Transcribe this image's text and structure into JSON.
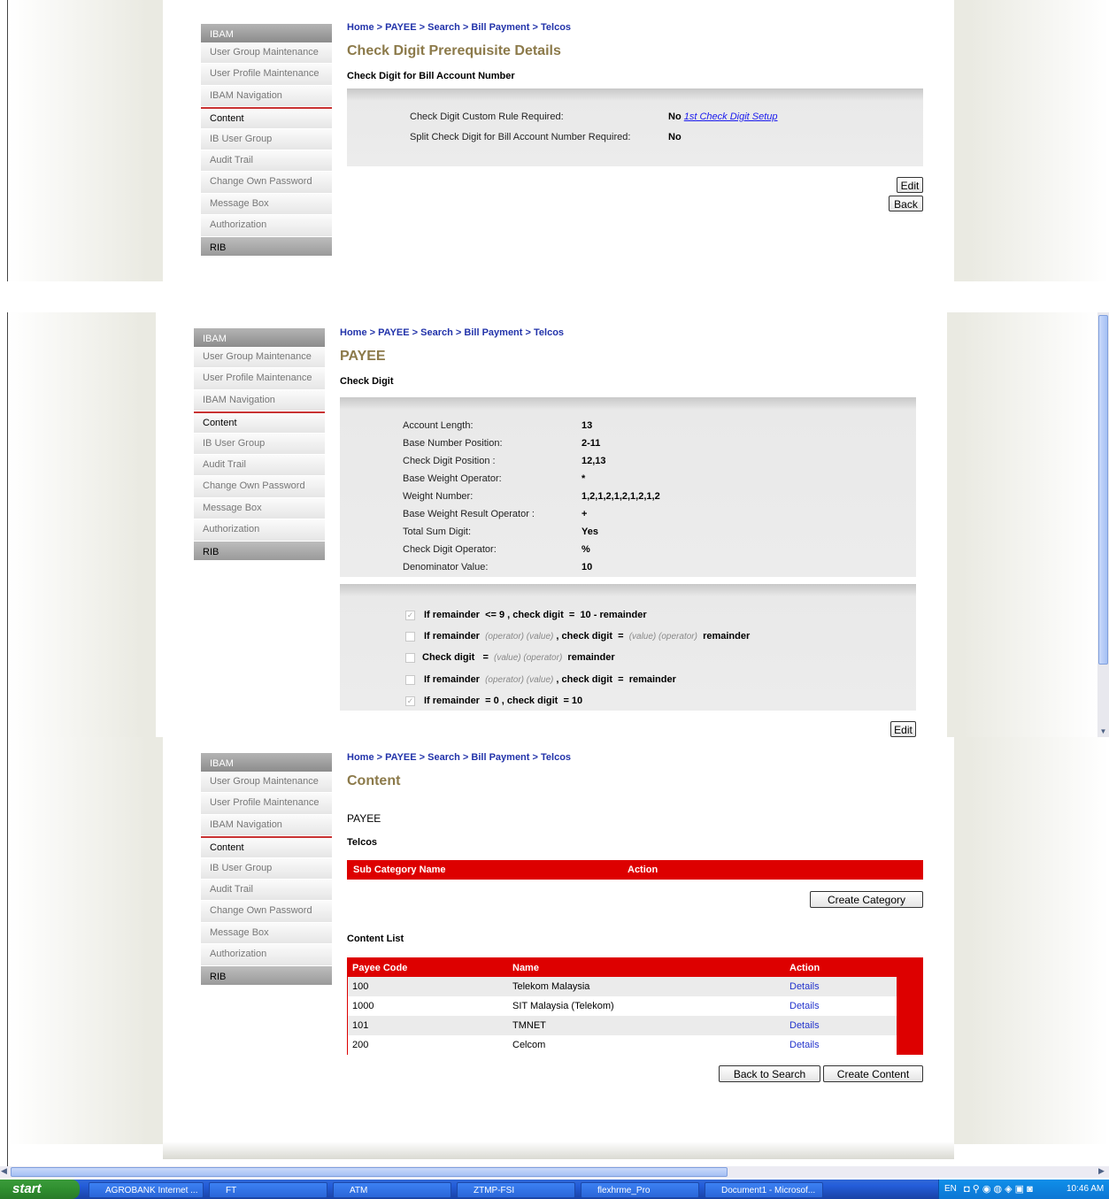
{
  "crumbs": {
    "home": "Home",
    "payee": "PAYEE",
    "search": "Search",
    "bill": "Bill Payment",
    "telcos": "Telcos",
    "sep": ">"
  },
  "sidebar": {
    "header": "IBAM",
    "items": [
      "User Group Maintenance",
      "User Profile Maintenance",
      "IBAM Navigation",
      "Content",
      "IB User Group",
      "Audit Trail",
      "Change Own Password",
      "Message Box",
      "Authorization"
    ],
    "footer": "RIB"
  },
  "panel1": {
    "title": "Check Digit Prerequisite Details",
    "subtitle": "Check Digit for Bill Account Number",
    "rows": [
      {
        "label": "Check Digit Custom Rule Required:",
        "value": "No",
        "link": "1st Check Digit Setup"
      },
      {
        "label": "Split Check Digit for Bill Account Number Required:",
        "value": "No"
      }
    ],
    "edit": "Edit",
    "back": "Back"
  },
  "panel2": {
    "title": "PAYEE",
    "subtitle": "Check Digit",
    "fields": [
      {
        "label": "Account Length:",
        "value": "13"
      },
      {
        "label": "Base Number Position:",
        "value": "2-11"
      },
      {
        "label": "Check Digit Position :",
        "value": "12,13"
      },
      {
        "label": "Base Weight Operator:",
        "value": "*"
      },
      {
        "label": "Weight Number:",
        "value": "1,2,1,2,1,2,1,2,1,2"
      },
      {
        "label": "Base Weight Result Operator :",
        "value": "+"
      },
      {
        "label": "Total Sum Digit:",
        "value": "Yes"
      },
      {
        "label": "Check Digit Operator:",
        "value": "%"
      },
      {
        "label": "Denominator Value:",
        "value": "10"
      }
    ],
    "rules": [
      {
        "checked": true,
        "a": "If remainder",
        "b": "<= 9 , check digit",
        "c": "=",
        "d": "10 - remainder"
      },
      {
        "checked": false,
        "a": "If remainder",
        "i1": "(operator) (value)",
        "b": ", check digit",
        "c": "=",
        "i2": "(value) (operator)",
        "d": "remainder"
      },
      {
        "checked": false,
        "a": "Check digit",
        "c": "=",
        "i2": "(value) (operator)",
        "d": "remainder"
      },
      {
        "checked": false,
        "a": "If remainder",
        "i1": "(operator) (value)",
        "b": ", check digit",
        "c": "=",
        "d": "remainder"
      },
      {
        "checked": true,
        "a": "If remainder",
        "b": "= 0 , check digit",
        "c": "= 10"
      }
    ],
    "edit": "Edit"
  },
  "panel3": {
    "title": "Content",
    "payee": "PAYEE",
    "telcos": "Telcos",
    "subcat_headers": [
      "Sub Category Name",
      "Action"
    ],
    "create_category": "Create Category",
    "content_list": "Content List",
    "list_headers": [
      "Payee Code",
      "Name",
      "Action"
    ],
    "rows": [
      {
        "code": "100",
        "name": "Telekom Malaysia",
        "action": "Details"
      },
      {
        "code": "1000",
        "name": "SIT Malaysia (Telekom)",
        "action": "Details"
      },
      {
        "code": "101",
        "name": "TMNET",
        "action": "Details"
      },
      {
        "code": "200",
        "name": "Celcom",
        "action": "Details"
      }
    ],
    "back_to_search": "Back to Search",
    "create_content": "Create Content"
  },
  "taskbar": {
    "start": "start",
    "items": [
      "AGROBANK Internet ...",
      "FT",
      "ATM",
      "ZTMP-FSI",
      "flexhrme_Pro",
      "Document1 - Microsof..."
    ],
    "lang": "EN",
    "clock": "10:46 AM"
  },
  "colors": {
    "title": "#8c7a4a",
    "link": "#2233aa",
    "table_header": "#dd0000",
    "accent_line": "#c83232"
  }
}
